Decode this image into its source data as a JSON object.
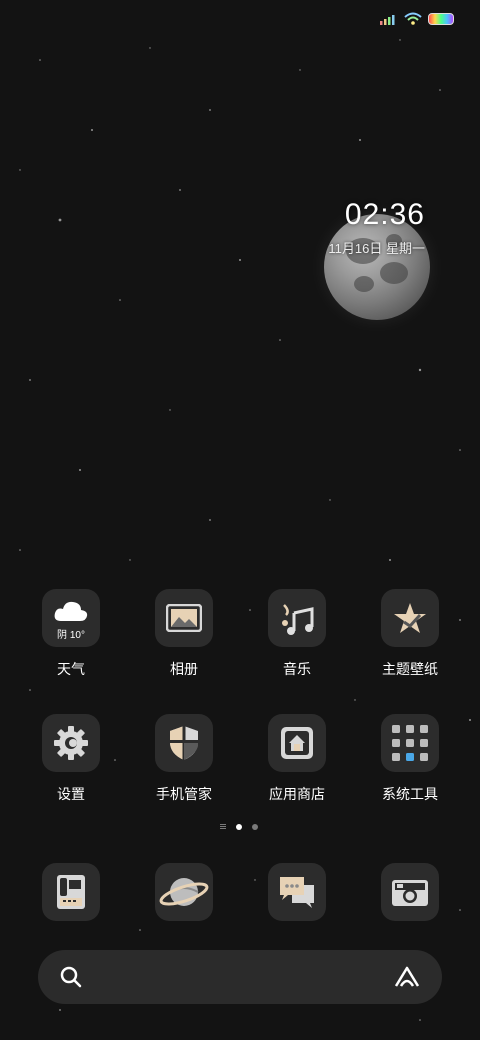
{
  "clock": {
    "time": "02:36",
    "date": "11月16日  星期一"
  },
  "apps": [
    {
      "name": "weather-app",
      "label": "天气",
      "weather": "阴 10°"
    },
    {
      "name": "gallery-app",
      "label": "相册"
    },
    {
      "name": "music-app",
      "label": "音乐"
    },
    {
      "name": "themes-app",
      "label": "主题壁纸"
    },
    {
      "name": "settings-app",
      "label": "设置"
    },
    {
      "name": "security-app",
      "label": "手机管家"
    },
    {
      "name": "appstore-app",
      "label": "应用商店"
    },
    {
      "name": "tools-folder",
      "label": "系统工具"
    }
  ],
  "dock": [
    "phone-icon",
    "browser-icon",
    "messages-icon",
    "camera-icon"
  ],
  "search": {
    "icon": "search-icon",
    "assistant": "assistant-icon"
  },
  "colors": {
    "tile": "#2c2c2c",
    "accent_beige": "#e7d2b5"
  }
}
